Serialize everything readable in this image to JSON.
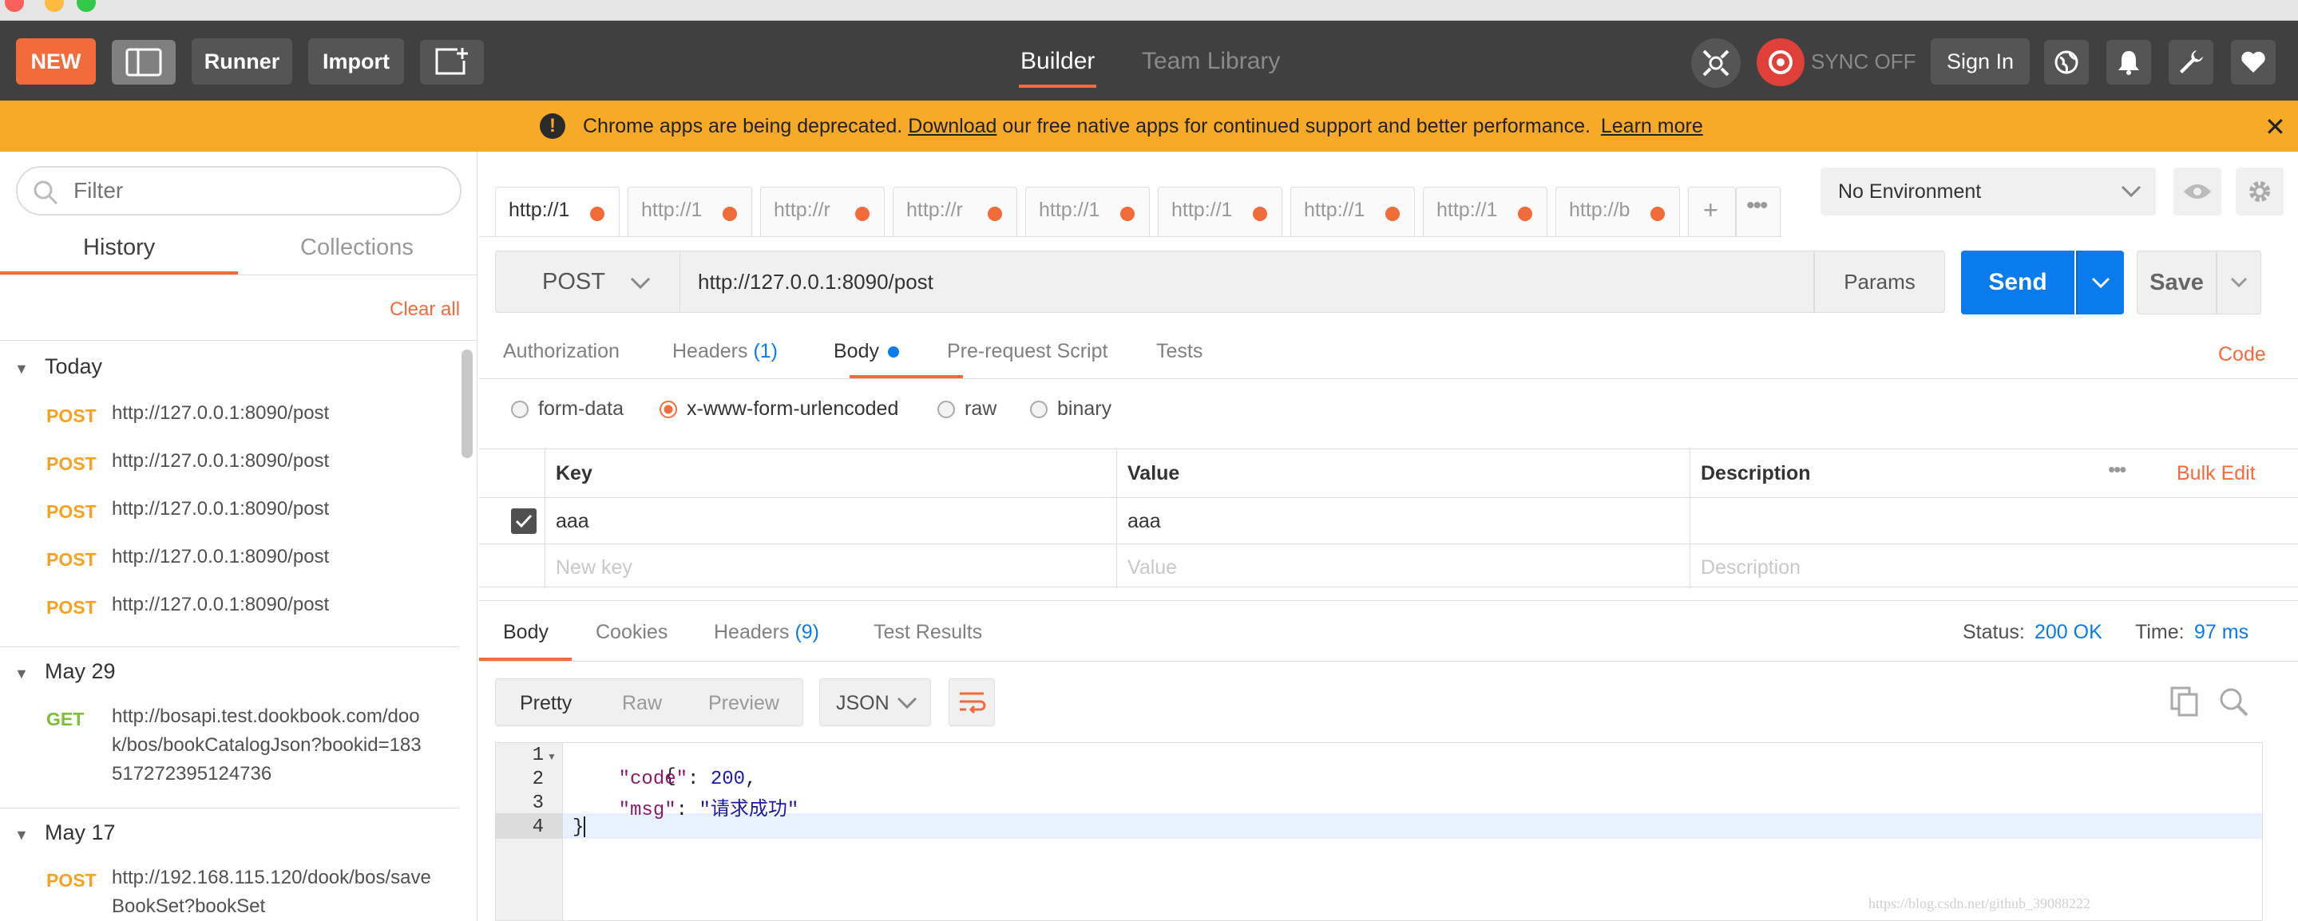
{
  "toolbar": {
    "new_label": "NEW",
    "runner_label": "Runner",
    "import_label": "Import",
    "tabs": [
      "Builder",
      "Team Library"
    ],
    "sync_label": "SYNC OFF",
    "signin_label": "Sign In"
  },
  "banner": {
    "text_before": "Chrome apps are being deprecated.",
    "download_link": "Download",
    "text_after": "our free native apps for continued support and better performance.",
    "learn_more": "Learn more"
  },
  "sidebar": {
    "filter_placeholder": "Filter",
    "tabs": [
      "History",
      "Collections"
    ],
    "clear_all": "Clear all",
    "groups": [
      {
        "label": "Today",
        "items": [
          {
            "method": "POST",
            "url": "http://127.0.0.1:8090/post"
          },
          {
            "method": "POST",
            "url": "http://127.0.0.1:8090/post"
          },
          {
            "method": "POST",
            "url": "http://127.0.0.1:8090/post"
          },
          {
            "method": "POST",
            "url": "http://127.0.0.1:8090/post"
          },
          {
            "method": "POST",
            "url": "http://127.0.0.1:8090/post"
          }
        ]
      },
      {
        "label": "May 29",
        "items": [
          {
            "method": "GET",
            "url": "http://bosapi.test.dookbook.com/dook/bos/bookCatalogJson?bookid=183517272395124736"
          }
        ]
      },
      {
        "label": "May 17",
        "items": [
          {
            "method": "POST",
            "url": "http://192.168.115.120/dook/bos/saveBookSet?bookSet"
          }
        ]
      }
    ]
  },
  "request_tabs": [
    "http://1",
    "http://1",
    "http://r",
    "http://r",
    "http://1",
    "http://1",
    "http://1",
    "http://1",
    "http://b"
  ],
  "environment": {
    "selected": "No Environment"
  },
  "request": {
    "method": "POST",
    "url": "http://127.0.0.1:8090/post",
    "params_label": "Params",
    "send_label": "Send",
    "save_label": "Save"
  },
  "request_subtabs": {
    "authorization": "Authorization",
    "headers": "Headers",
    "headers_count": "(1)",
    "body": "Body",
    "prerequest": "Pre-request Script",
    "tests": "Tests",
    "code": "Code"
  },
  "body_modes": [
    "form-data",
    "x-www-form-urlencoded",
    "raw",
    "binary"
  ],
  "params_table": {
    "headers": [
      "Key",
      "Value",
      "Description"
    ],
    "bulk_edit": "Bulk Edit",
    "rows": [
      {
        "key": "aaa",
        "value": "aaa",
        "description": ""
      }
    ],
    "placeholders": {
      "key": "New key",
      "value": "Value",
      "description": "Description"
    }
  },
  "response": {
    "tabs": {
      "body": "Body",
      "cookies": "Cookies",
      "headers": "Headers",
      "headers_count": "(9)",
      "test_results": "Test Results"
    },
    "status_label": "Status:",
    "status_value": "200 OK",
    "time_label": "Time:",
    "time_value": "97 ms",
    "view_modes": [
      "Pretty",
      "Raw",
      "Preview"
    ],
    "format": "JSON",
    "code_lines": [
      {
        "n": "1",
        "parts": [
          {
            "t": "{",
            "c": "#222"
          }
        ]
      },
      {
        "n": "2",
        "parts": [
          {
            "t": "    ",
            "c": "#222"
          },
          {
            "t": "\"code\"",
            "c": "#8a1a6e"
          },
          {
            "t": ": ",
            "c": "#222"
          },
          {
            "t": "200",
            "c": "#1a1aa6"
          },
          {
            "t": ",",
            "c": "#222"
          }
        ]
      },
      {
        "n": "3",
        "parts": [
          {
            "t": "    ",
            "c": "#222"
          },
          {
            "t": "\"msg\"",
            "c": "#8a1a6e"
          },
          {
            "t": ": ",
            "c": "#222"
          },
          {
            "t": "\"请求成功\"",
            "c": "#1a1aa6"
          }
        ]
      },
      {
        "n": "4",
        "parts": [
          {
            "t": "}",
            "c": "#222"
          }
        ]
      }
    ]
  },
  "watermark": "https://blog.csdn.net/github_39088222",
  "colors": {
    "accent": "#f26b3a",
    "send_blue": "#097bed",
    "banner": "#f7a928",
    "get_green": "#80bd3b",
    "post_orange": "#f6a220"
  }
}
